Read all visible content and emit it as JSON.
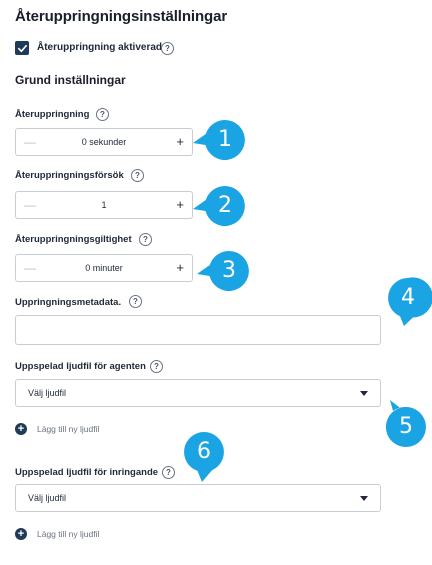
{
  "page": {
    "title": "Återuppringningsinställningar",
    "enabled_checkbox": {
      "label": "Återuppringning aktiverad",
      "checked": true
    },
    "section_title": "Grund inställningar"
  },
  "fields": {
    "callback": {
      "label": "Återuppringning",
      "value": "0 sekunder"
    },
    "attempts": {
      "label": "Återuppringningsförsök",
      "value": "1"
    },
    "validity": {
      "label": "Återuppringningsgiltighet",
      "value": "0 minuter"
    },
    "metadata": {
      "label": "Uppringningsmetadata.",
      "value": ""
    },
    "agent_audio": {
      "label": "Uppspelad ljudfil för agenten",
      "value": "Välj ljudfil",
      "add_label": "Lägg till ny ljudfil"
    },
    "caller_audio": {
      "label": "Uppspelad ljudfil för inringande",
      "value": "Välj ljudfil",
      "add_label": "Lägg till ny ljudfil"
    }
  },
  "stepper_symbols": {
    "minus": "—",
    "plus": "+"
  },
  "help_symbol": "?",
  "callouts": [
    "1",
    "2",
    "3",
    "4",
    "5",
    "6"
  ],
  "colors": {
    "callout": "#1ba4e3",
    "checkbox": "#1f3b57",
    "border": "#c9ccd1"
  }
}
